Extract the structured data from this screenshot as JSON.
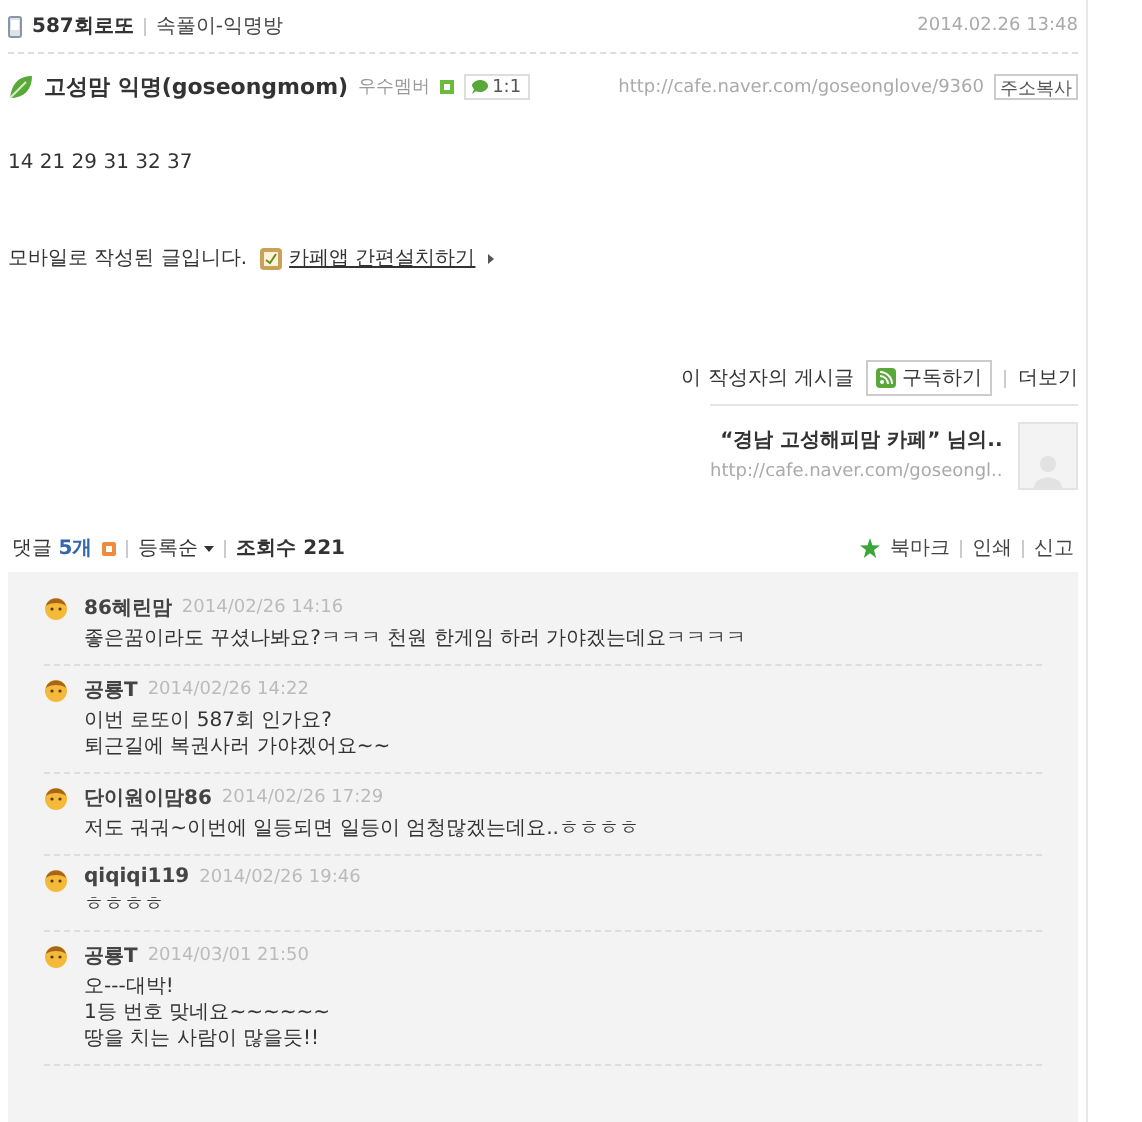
{
  "post": {
    "title": "587회로또",
    "board": "속풀이-익명방",
    "date": "2014.02.26 13:48"
  },
  "author": {
    "name": "고성맘 익명(goseongmom)",
    "grade": "우수멤버",
    "chat": "1:1",
    "url": "http://cafe.naver.com/goseonglove/9360",
    "copy_button": "주소복사"
  },
  "body": {
    "text": "14 21 29 31 32 37"
  },
  "mobile_note": {
    "text": "모바일로 작성된 글입니다.",
    "link": "카페앱 간편설치하기"
  },
  "author_posts": {
    "label": "이 작성자의 게시글",
    "subscribe": "구독하기",
    "more": "더보기",
    "card_title": "“경남 고성해피맘 카페” 님의..",
    "card_url": "http://cafe.naver.com/goseongl.."
  },
  "comments_bar": {
    "label": "댓글",
    "count": "5개",
    "sort": "등록순",
    "views": "조회수 221",
    "actions": [
      "북마크",
      "인쇄",
      "신고"
    ]
  },
  "comments": [
    {
      "author": "86혜린맘",
      "date": "2014/02/26 14:16",
      "lines": [
        "좋은꿈이라도 꾸셨나봐요?ㅋㅋㅋ 천원 한게임 하러 가야겠는데요ㅋㅋㅋㅋ"
      ]
    },
    {
      "author": "공룡T",
      "date": "2014/02/26 14:22",
      "lines": [
        "이번 로또이 587회 인가요?",
        "퇴근길에 복권사러 가야겠어요~~"
      ]
    },
    {
      "author": "단이원이맘86",
      "date": "2014/02/26 17:29",
      "lines": [
        "저도 궈궈~이번에 일등되면 일등이 엄청많겠는데요..ㅎㅎㅎㅎ"
      ]
    },
    {
      "author": "qiqiqi119",
      "date": "2014/02/26 19:46",
      "lines": [
        "ㅎㅎㅎㅎ"
      ]
    },
    {
      "author": "공룡T",
      "date": "2014/03/01 21:50",
      "lines": [
        "오---대박!",
        "1등 번호 맞네요~~~~~~",
        "땅을 치는 사람이 많을듯!!"
      ]
    }
  ]
}
